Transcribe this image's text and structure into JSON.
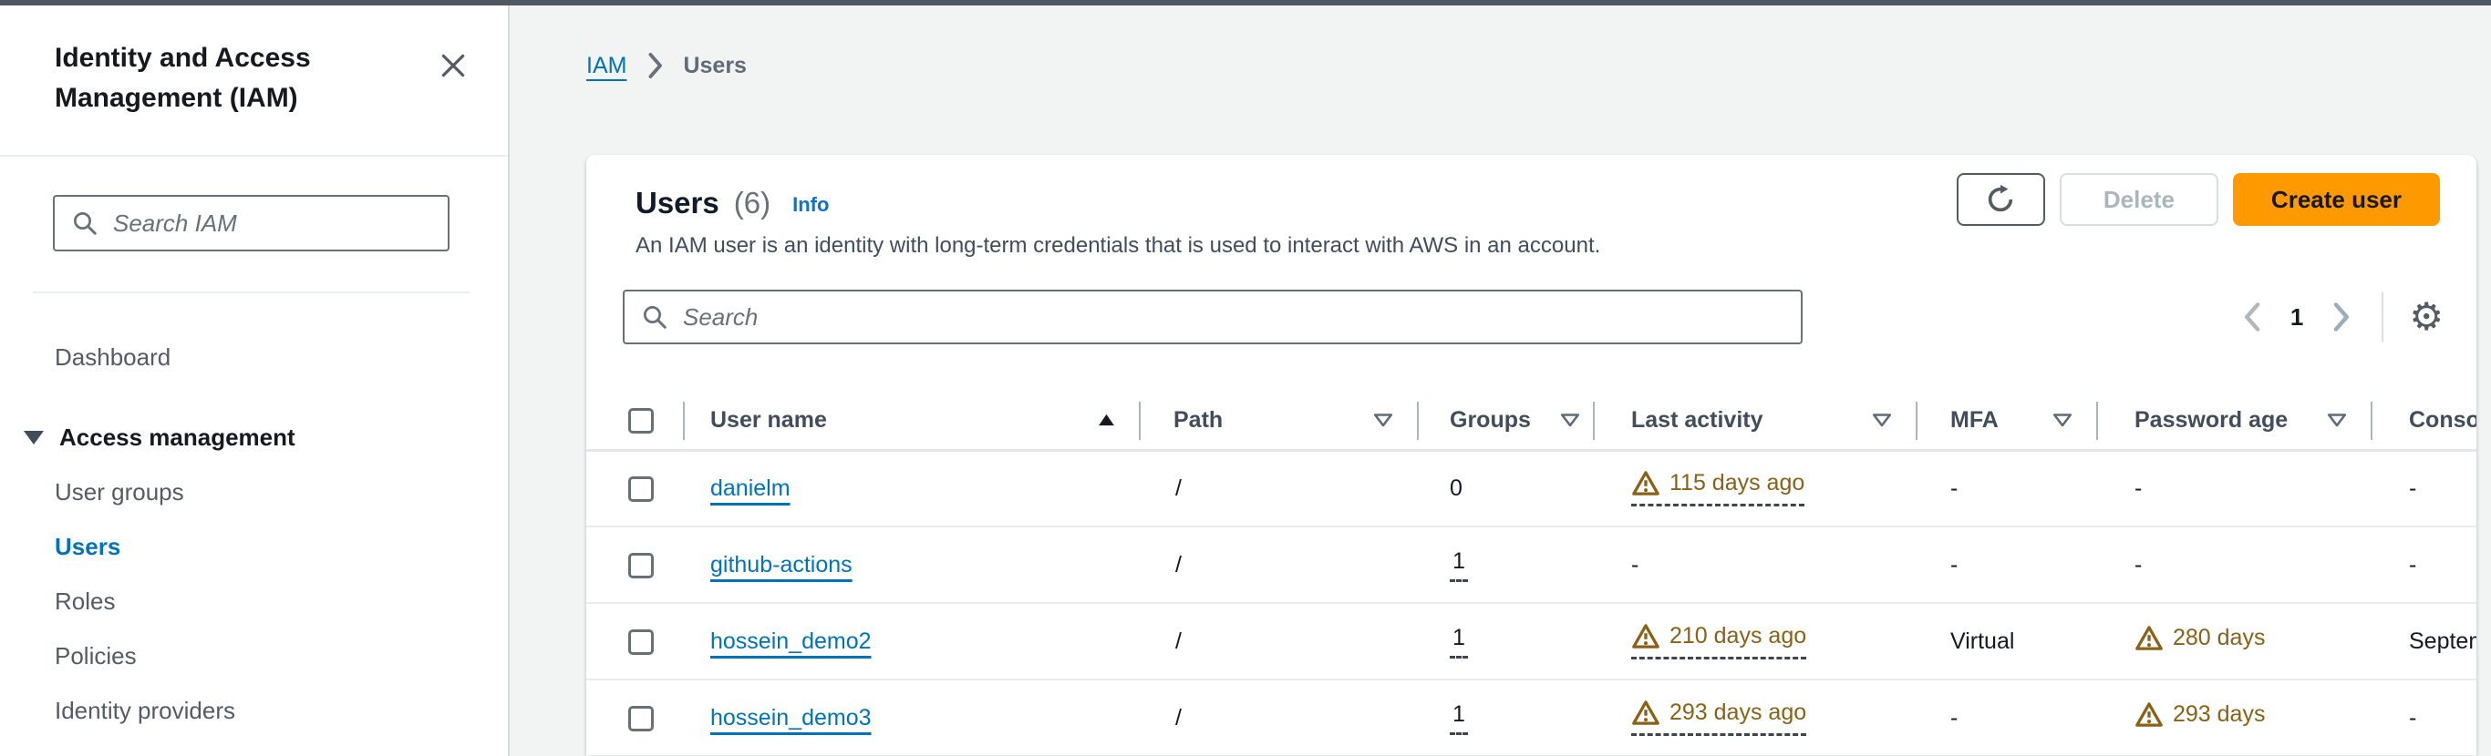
{
  "sidebar": {
    "title": "Identity and Access Management (IAM)",
    "search_placeholder": "Search IAM",
    "items": [
      {
        "label": "Dashboard"
      },
      {
        "label": "Access management",
        "expanded": true
      },
      {
        "label": "User groups"
      },
      {
        "label": "Users",
        "active": true
      },
      {
        "label": "Roles"
      },
      {
        "label": "Policies"
      },
      {
        "label": "Identity providers"
      }
    ]
  },
  "breadcrumb": {
    "items": [
      "IAM",
      "Users"
    ]
  },
  "main": {
    "header": {
      "title": "Users",
      "count": "(6)",
      "info_label": "Info",
      "description": "An IAM user is an identity with long-term credentials that is used to interact with AWS in an account."
    },
    "actions": {
      "delete_label": "Delete",
      "create_label": "Create user"
    },
    "filter": {
      "placeholder": "Search"
    },
    "pagination": {
      "current_page": "1"
    },
    "table": {
      "columns": [
        {
          "id": "select",
          "label": ""
        },
        {
          "id": "user_name",
          "label": "User name",
          "sorted": "ascending"
        },
        {
          "id": "path",
          "label": "Path"
        },
        {
          "id": "groups",
          "label": "Groups"
        },
        {
          "id": "last_activity",
          "label": "Last activity"
        },
        {
          "id": "mfa",
          "label": "MFA"
        },
        {
          "id": "password_age",
          "label": "Password age"
        },
        {
          "id": "console_last_sign_in",
          "label": "Console last sign-in",
          "clipped_at_right_edge": true
        }
      ],
      "rows": [
        {
          "user_name": "danielm",
          "path": "/",
          "groups": "0",
          "last_activity": {
            "warning": true,
            "text": "115 days ago"
          },
          "mfa": "-",
          "password_age": {
            "warning": false,
            "text": "-"
          },
          "console_last_sign_in": "-"
        },
        {
          "user_name": "github-actions",
          "path": "/",
          "groups": "1",
          "last_activity": {
            "warning": false,
            "text": "-"
          },
          "mfa": "-",
          "password_age": {
            "warning": false,
            "text": "-"
          },
          "console_last_sign_in": "-"
        },
        {
          "user_name": "hossein_demo2",
          "path": "/",
          "groups": "1",
          "last_activity": {
            "warning": true,
            "text": "210 days ago"
          },
          "mfa": "Virtual",
          "password_age": {
            "warning": true,
            "text": "280 days"
          },
          "console_last_sign_in": "September"
        },
        {
          "user_name": "hossein_demo3",
          "path": "/",
          "groups": "1",
          "last_activity": {
            "warning": true,
            "text": "293 days ago"
          },
          "mfa": "-",
          "password_age": {
            "warning": true,
            "text": "293 days"
          },
          "console_last_sign_in": "-"
        }
      ]
    }
  },
  "colors": {
    "primary_button_orange": "#ff9900",
    "link_blue": "#0073bb",
    "warning_amber": "#8a6116",
    "top_edge_bar": "#4f5760",
    "page_background": "#f2f3f3"
  },
  "icons": {
    "close": "x-mark",
    "search": "magnifier",
    "refresh": "circular-arrow",
    "settings": "gear",
    "sort_ascending": "filled-up-triangle",
    "filter": "outlined-down-triangle",
    "warning": "exclamation-triangle",
    "breadcrumb_separator": "chevron-right",
    "pagination_prev": "chevron-left",
    "pagination_next": "chevron-right",
    "access_management_caret": "filled-down-triangle"
  }
}
